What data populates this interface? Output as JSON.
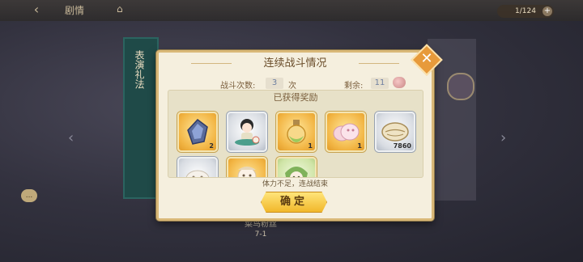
{
  "top_bar": {
    "title": "剧情",
    "stamina": "1/124"
  },
  "scroll": {
    "text": "表演礼法"
  },
  "chat": {
    "label": "..."
  },
  "under_dialog": {
    "label": "菜鸟粉丝",
    "sub": "7-1"
  },
  "dialog": {
    "title": "连续战斗情况",
    "battle_count_label": "战斗次数:",
    "battle_count_value": "3",
    "battle_count_unit": "次",
    "remaining_label": "剩余:",
    "remaining_value": "11",
    "rewards_header": "已获得奖励",
    "rewards": [
      {
        "icon": "blue-crystal-icon",
        "qty": "2",
        "rarity": "gold"
      },
      {
        "icon": "character-chibi-icon",
        "qty": "",
        "rarity": "gray"
      },
      {
        "icon": "potion-bottle-icon",
        "qty": "1",
        "rarity": "gold"
      },
      {
        "icon": "pink-bun-icon",
        "qty": "1",
        "rarity": "gold"
      },
      {
        "icon": "seashell-icon",
        "qty": "7860",
        "rarity": "gray"
      },
      {
        "icon": "white-bun-icon",
        "qty": "",
        "rarity": "gray"
      },
      {
        "icon": "character-chibi-icon",
        "qty": "",
        "rarity": "gold"
      },
      {
        "icon": "character-chibi-icon",
        "qty": "",
        "rarity": "green"
      }
    ],
    "status_text": "体力不足，连战结束",
    "confirm_label": "确定"
  },
  "colors": {
    "dialog_bg": "#f5efde",
    "dialog_border": "#d9b878",
    "confirm_gold": "#f1b72b",
    "close_orange": "#e79a3b"
  }
}
